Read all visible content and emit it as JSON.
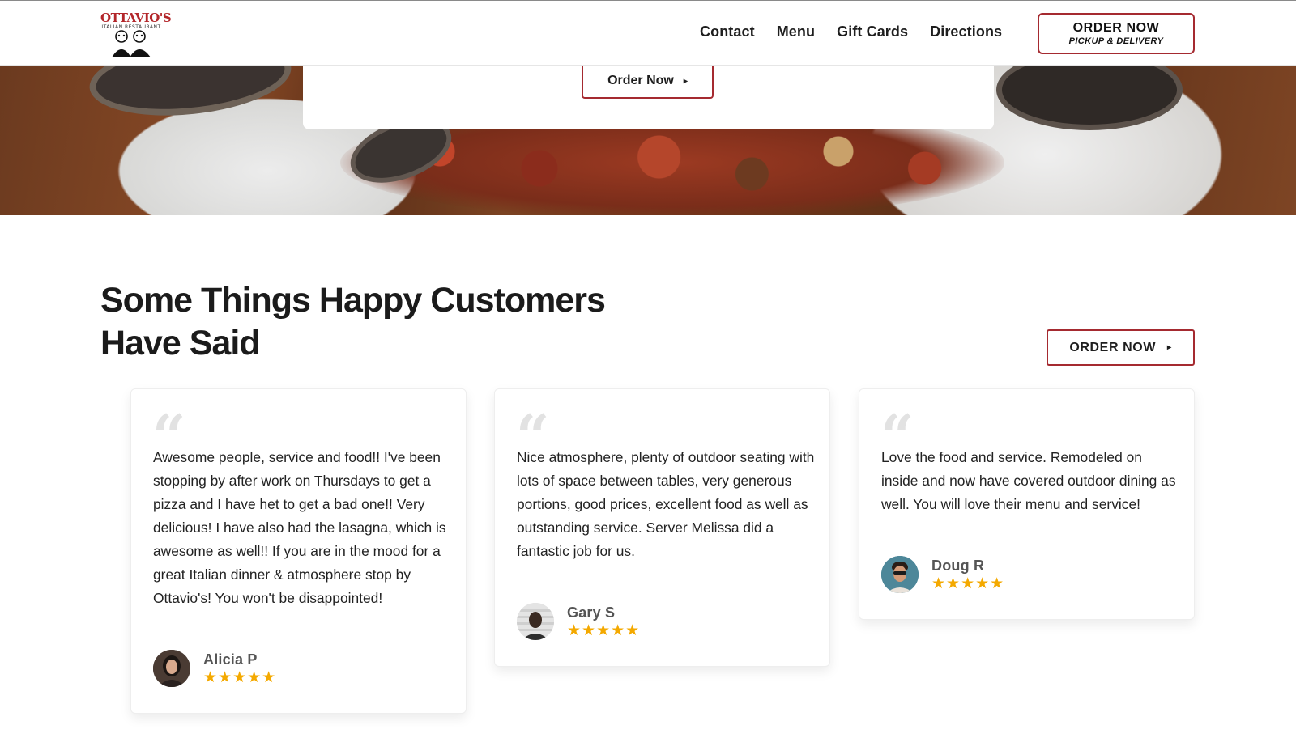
{
  "brand": {
    "logo_text": "OTTAVIO'S",
    "logo_subtext": "ITALIAN RESTAURANT",
    "accent_color": "#a52a30",
    "star_color": "#f4a900"
  },
  "nav": {
    "items": [
      "Contact",
      "Menu",
      "Gift Cards",
      "Directions"
    ]
  },
  "header_cta": {
    "line1": "ORDER NOW",
    "line2": "PICKUP & DELIVERY"
  },
  "hero": {
    "order_label": "Order Now"
  },
  "testimonials": {
    "title_line1": "Some Things Happy Customers",
    "title_line2": "Have Said",
    "order_label": "ORDER NOW",
    "reviews": [
      {
        "text": "Awesome people, service and food!! I've been stopping by after work on Thursdays to get a pizza and I have het to get a bad one!! Very delicious! I have also had the lasagna, which is awesome as well!! If you are in the mood for a great Italian dinner & atmosphere stop by Ottavio's! You won't be disappointed!",
        "name": "Alicia P",
        "stars": "★★★★★"
      },
      {
        "text": "Nice atmosphere, plenty of outdoor seating with lots of space between tables, very generous portions, good prices, excellent food as well as outstanding service. Server Melissa did a fantastic job for us.",
        "name": "Gary S",
        "stars": "★★★★★"
      },
      {
        "text": "Love the food and service. Remodeled on inside and now have covered outdoor dining as well. You will love their menu and service!",
        "name": "Doug R",
        "stars": "★★★★★"
      }
    ]
  }
}
